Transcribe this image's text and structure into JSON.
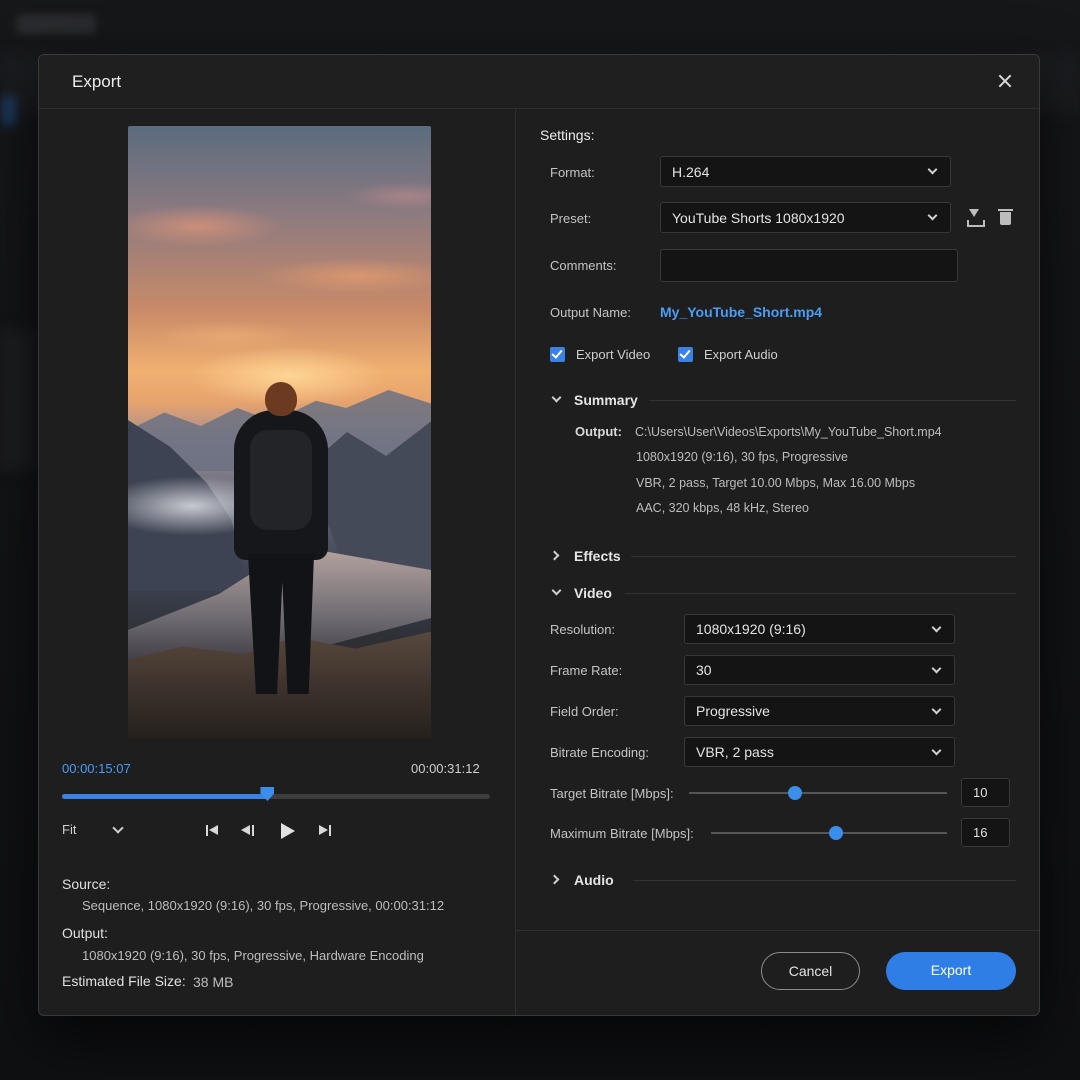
{
  "dialog": {
    "title": "Export"
  },
  "player": {
    "current_time": "00:00:15:07",
    "total_time": "00:00:31:12",
    "progress": 0.48,
    "fit_label": "Fit"
  },
  "info": {
    "source_label": "Source:",
    "source_value": "Sequence, 1080x1920 (9:16), 30 fps, Progressive, 00:00:31:12",
    "output_label": "Output:",
    "output_value": "1080x1920 (9:16), 30 fps, Progressive, Hardware Encoding",
    "size_label": "Estimated File Size:",
    "size_value": "38 MB"
  },
  "settings": {
    "title": "Settings:",
    "format_label": "Format:",
    "format_value": "H.264",
    "preset_label": "Preset:",
    "preset_value": "YouTube Shorts 1080x1920",
    "comments_label": "Comments:",
    "comments_value": "",
    "output_name_label": "Output Name:",
    "output_name_value": "My_YouTube_Short.mp4",
    "export_video_label": "Export Video",
    "export_audio_label": "Export Audio"
  },
  "summary": {
    "title": "Summary",
    "output_key": "Output:",
    "lines": [
      "C:\\Users\\User\\Videos\\Exports\\My_YouTube_Short.mp4",
      "1080x1920 (9:16), 30 fps, Progressive",
      "VBR, 2 pass, Target 10.00 Mbps, Max 16.00 Mbps",
      "AAC, 320 kbps, 48 kHz, Stereo"
    ]
  },
  "effects": {
    "title": "Effects"
  },
  "video": {
    "title": "Video",
    "resolution_label": "Resolution:",
    "resolution_value": "1080x1920 (9:16)",
    "frame_rate_label": "Frame Rate:",
    "frame_rate_value": "30",
    "field_order_label": "Field Order:",
    "field_order_value": "Progressive",
    "bitrate_encoding_label": "Bitrate Encoding:",
    "bitrate_encoding_value": "VBR, 2 pass",
    "target_bitrate_label": "Target Bitrate [Mbps]:",
    "target_bitrate_value": "10",
    "target_bitrate_fraction": 0.41,
    "max_bitrate_label": "Maximum Bitrate [Mbps]:",
    "max_bitrate_value": "16",
    "max_bitrate_fraction": 0.53
  },
  "audio": {
    "title": "Audio"
  },
  "footer": {
    "cancel_label": "Cancel",
    "export_label": "Export"
  }
}
